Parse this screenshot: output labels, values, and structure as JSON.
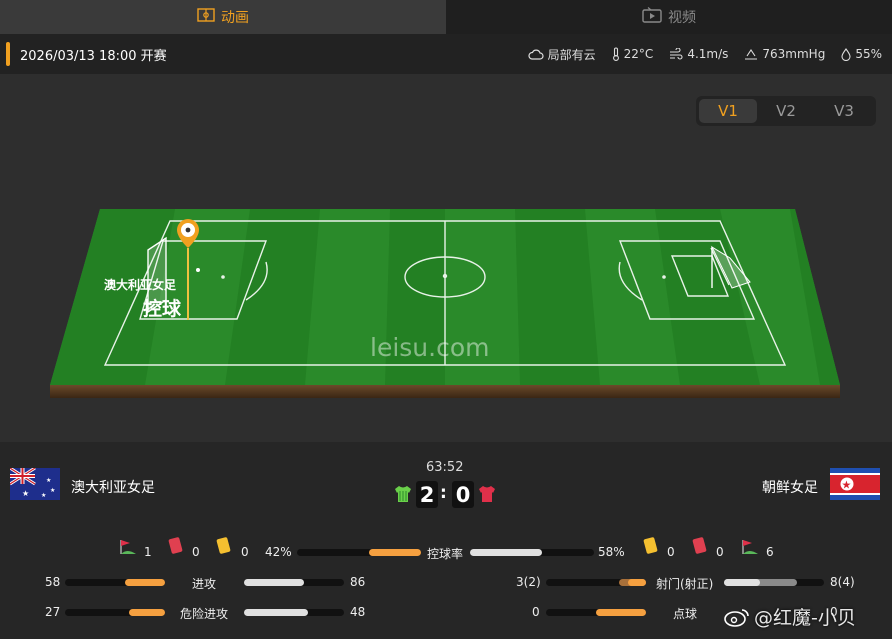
{
  "tabs": {
    "animation": "动画",
    "video": "视频"
  },
  "match": {
    "time": "2026/03/13 18:00 开赛"
  },
  "weather": {
    "sky": "局部有云",
    "temp": "22°C",
    "wind": "4.1m/s",
    "pressure": "763mmHg",
    "humidity": "55%"
  },
  "views": [
    "V1",
    "V2",
    "V3"
  ],
  "pitch": {
    "watermark": "leisu.com",
    "team_label": "澳大利亚女足",
    "action": "控球"
  },
  "home": {
    "name": "澳大利亚女足",
    "corners": "1",
    "red": "0",
    "yellow": "0"
  },
  "away": {
    "name": "朝鲜女足",
    "corners": "6",
    "red": "0",
    "yellow": "0"
  },
  "clock": "63:52",
  "score": {
    "home": "2",
    "sep": ":",
    "away": "0"
  },
  "stats": {
    "possession": {
      "label": "控球率",
      "home": "42%",
      "away": "58%",
      "home_frac": 0.42,
      "away_frac": 0.58
    },
    "attacks": {
      "label": "进攻",
      "home": "58",
      "away": "86"
    },
    "dangerous": {
      "label": "危险进攻",
      "home": "27",
      "away": "48"
    },
    "shots": {
      "label": "射门(射正)",
      "home": "3(2)",
      "away": "8(4)"
    },
    "penalties": {
      "label": "点球",
      "home": "0",
      "away": "0"
    }
  },
  "watermark2": "@红魔-小贝",
  "colors": {
    "accent": "#f0a020",
    "home_bar": "#f5a040",
    "away_bar": "#e0e0e0"
  }
}
